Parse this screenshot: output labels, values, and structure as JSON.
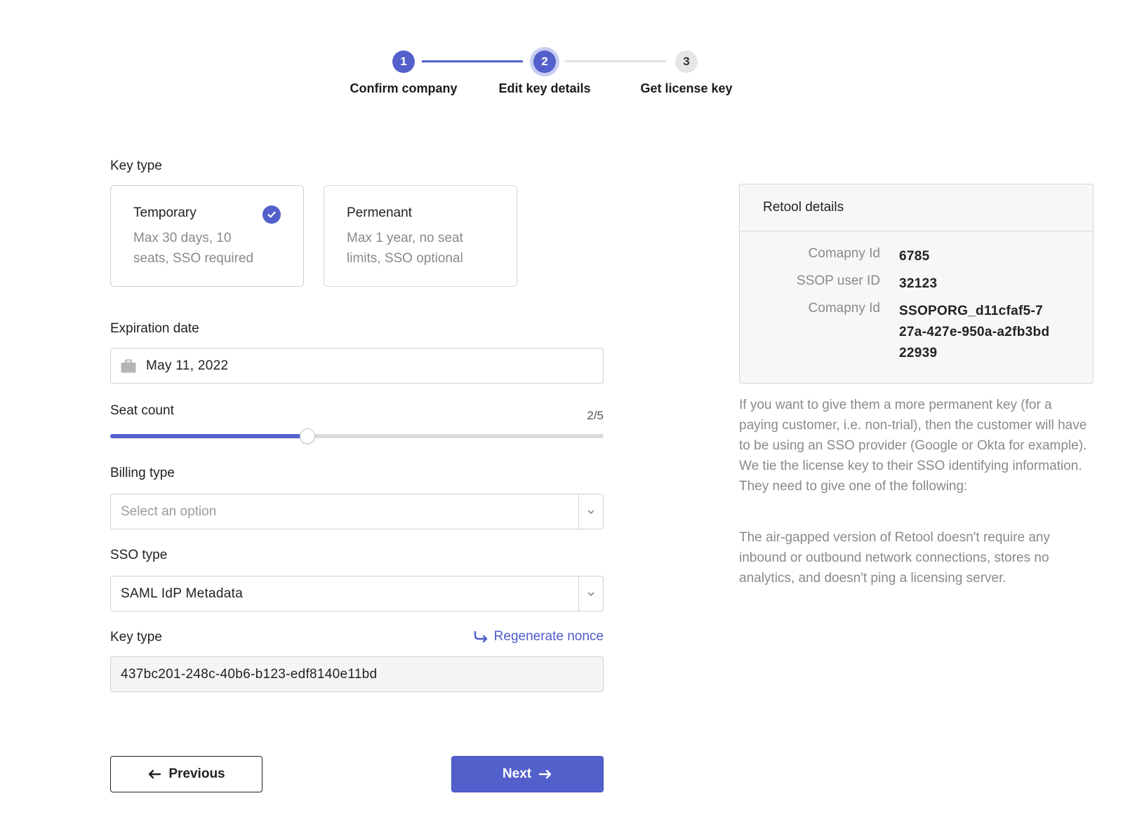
{
  "stepper": {
    "steps": [
      {
        "number": "1",
        "label": "Confirm company",
        "state": "done"
      },
      {
        "number": "2",
        "label": "Edit key details",
        "state": "active"
      },
      {
        "number": "3",
        "label": "Get license key",
        "state": "todo"
      }
    ]
  },
  "form": {
    "key_type_label": "Key type",
    "key_types": [
      {
        "title": "Temporary",
        "description": "Max 30 days, 10 seats, SSO required",
        "selected": true
      },
      {
        "title": "Permenant",
        "description": "Max 1 year, no seat limits, SSO optional",
        "selected": false
      }
    ],
    "expiration": {
      "label": "Expiration date",
      "value": "May 11, 2022",
      "icon": "briefcase-icon"
    },
    "seat_count": {
      "label": "Seat count",
      "value_text": "2/5",
      "fraction": 0.4
    },
    "billing_type": {
      "label": "Billing type",
      "placeholder": "Select an option"
    },
    "sso_type": {
      "label": "SSO type",
      "value": "SAML IdP Metadata"
    },
    "nonce": {
      "label": "Key type",
      "regenerate_label": "Regenerate nonce",
      "value": "437bc201-248c-40b6-b123-edf8140e11bd"
    },
    "previous_label": "Previous",
    "next_label": "Next"
  },
  "details": {
    "title": "Retool details",
    "rows": [
      {
        "key": "Comapny Id",
        "value": "6785"
      },
      {
        "key": "SSOP user ID",
        "value": "32123"
      },
      {
        "key": "Comapny Id",
        "value": "SSOPORG_d11cfaf5-727a-427e-950a-a2fb3bd22939"
      }
    ]
  },
  "help": {
    "paragraph1": "If you want to give them a more permanent key (for a paying customer, i.e. non-trial), then the customer will have to be using an SSO provider (Google or Okta for example). We tie the license key to their SSO identifying information. They need to give one of the following:",
    "paragraph2": "The air-gapped version of Retool doesn't require any inbound or outbound network connections, stores no analytics, and doesn't ping a licensing server."
  },
  "colors": {
    "accent": "#5360cc",
    "accent_ring": "#c9cdf1",
    "muted_text": "#8a8a8a"
  }
}
